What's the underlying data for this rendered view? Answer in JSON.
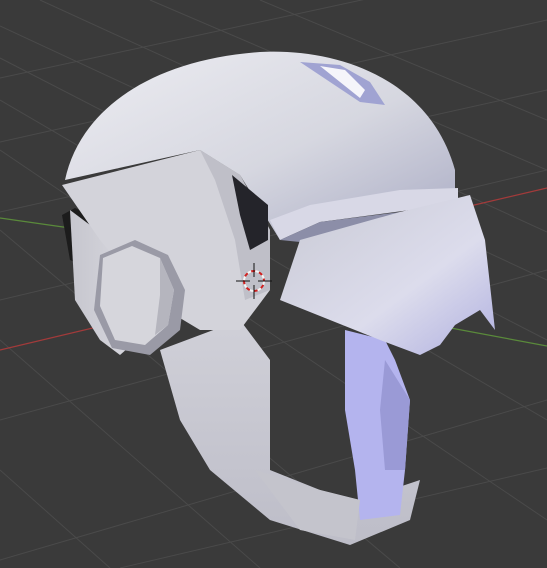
{
  "viewport": {
    "view": "3D viewport",
    "shading": "solid"
  },
  "colors": {
    "background": "#3a3a3a",
    "grid_line": "#4a4a4a",
    "x_axis": "#a33a3a",
    "y_axis": "#5a8a3a",
    "mesh_light": "#e4e4ea",
    "mesh_mid": "#bfc0cc",
    "mesh_shadow": "#8c8ea8",
    "mesh_tint": "#b6b4e8",
    "cursor_red": "#d02020",
    "cursor_white": "#f4f4f4"
  },
  "scene": {
    "object": "helmet-mesh",
    "cursor": "3d-cursor-icon"
  }
}
